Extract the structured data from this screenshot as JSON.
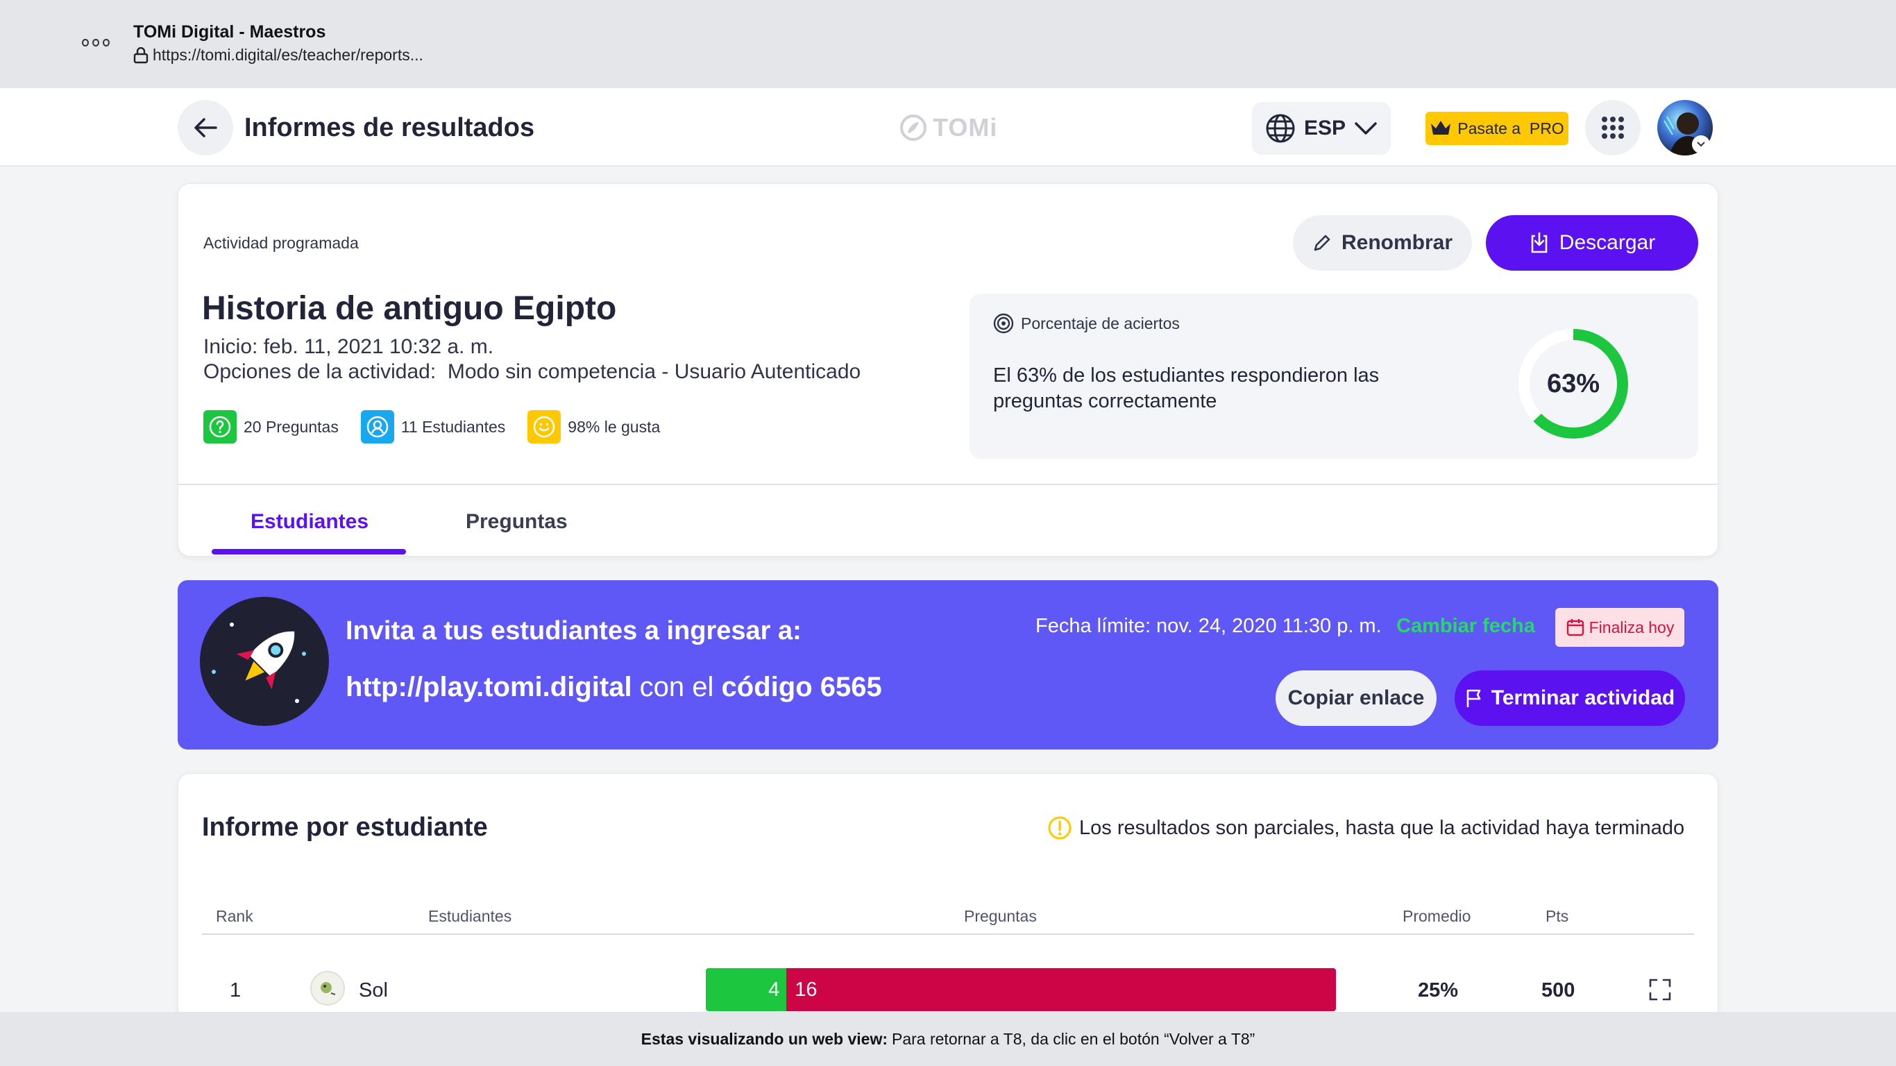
{
  "browser": {
    "title": "TOMi Digital - Maestros",
    "url": "https://tomi.digital/es/teacher/reports..."
  },
  "header": {
    "title": "Informes de resultados",
    "logo_text": "TOMi",
    "language": "ESP",
    "pro_label": "Pasate a  PRO"
  },
  "activity": {
    "kind": "Actividad programada",
    "title": "Historia de antiguo Egipto",
    "start": "Inicio: feb. 11, 2021 10:32 a. m.",
    "options": "Opciones de la actividad:  Modo sin competencia - Usuario Autenticado",
    "stats": {
      "questions": "20 Preguntas",
      "students": "11 Estudiantes",
      "likes": "98% le gusta"
    },
    "rename_label": "Renombrar",
    "download_label": "Descargar",
    "score": {
      "label": "Porcentaje de aciertos",
      "text": "El 63% de los estudiantes respondieron las preguntas correctamente",
      "value": "63%",
      "fraction": 0.63
    },
    "tabs": [
      "Estudiantes",
      "Preguntas"
    ],
    "active_tab": "Estudiantes"
  },
  "invite": {
    "title": "Invita a tus estudiantes a ingresar a:",
    "link": "http://play.tomi.digital",
    "link_middle": " con el ",
    "code_label": "código 6565",
    "deadline": "Fecha límite: nov. 24, 2020 11:30 p. m.",
    "change_date": "Cambiar fecha",
    "ends_badge": "Finaliza hoy",
    "copy_label": "Copiar enlace",
    "end_label": "Terminar actividad"
  },
  "report": {
    "title": "Informe por estudiante",
    "partial_note": "Los resultados son parciales, hasta que la actividad haya terminado",
    "columns": {
      "rank": "Rank",
      "students": "Estudiantes",
      "questions": "Preguntas",
      "average": "Promedio",
      "points": "Pts"
    },
    "rows": [
      {
        "rank": "1",
        "name": "Sol",
        "correct": "4",
        "wrong": "16",
        "correct_fraction": 0.128,
        "average": "25%",
        "points": "500"
      }
    ]
  },
  "footer": {
    "bold": "Estas visualizando un web view:",
    "text": "Para retornar a T8, da clic en el botón “Volver a T8”"
  },
  "colors": {
    "primary": "#5b11f0",
    "banner": "#6058f6",
    "correct": "#1cc63f",
    "wrong": "#cd0445",
    "pro": "#ffc800"
  }
}
